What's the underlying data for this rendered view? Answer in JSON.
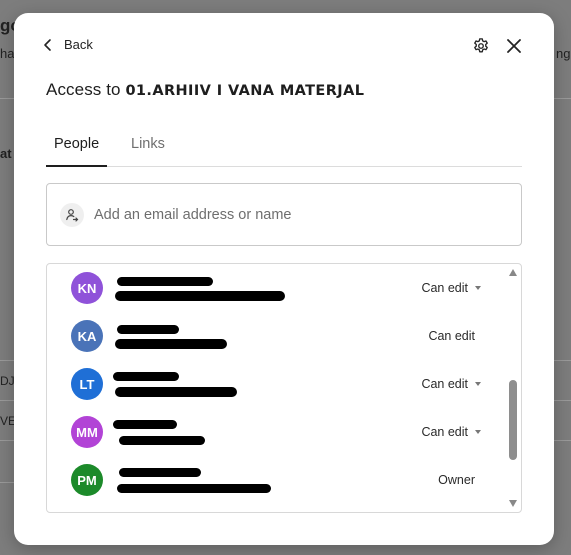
{
  "dialog": {
    "back_label": "Back",
    "title_prefix": "Access to",
    "folder_name": "01.ARHIIV I VANA MATERJAL"
  },
  "tabs": [
    {
      "label": "People",
      "active": true
    },
    {
      "label": "Links",
      "active": false
    }
  ],
  "search": {
    "placeholder": "Add an email address or name",
    "value": ""
  },
  "members": [
    {
      "initials": "KN",
      "color": "#8f52d9",
      "permission": "Can edit",
      "has_dropdown": true
    },
    {
      "initials": "KA",
      "color": "#4a73b8",
      "permission": "Can edit",
      "has_dropdown": false
    },
    {
      "initials": "LT",
      "color": "#1f6fd6",
      "permission": "Can edit",
      "has_dropdown": true
    },
    {
      "initials": "MM",
      "color": "#b243d6",
      "permission": "Can edit",
      "has_dropdown": true
    },
    {
      "initials": "PM",
      "color": "#1c8a2a",
      "permission": "Owner",
      "has_dropdown": false
    }
  ],
  "icons": {
    "back": "chevron-left-icon",
    "settings": "gear-icon",
    "close": "close-icon",
    "add_person": "add-person-icon"
  }
}
